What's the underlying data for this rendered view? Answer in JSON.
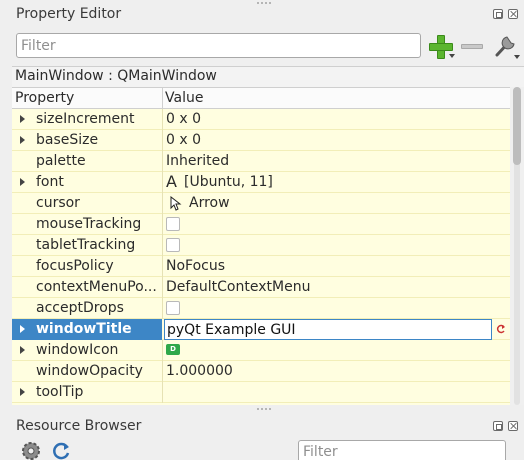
{
  "property_editor": {
    "title": "Property Editor",
    "filter_placeholder": "Filter",
    "object_label": "MainWindow : QMainWindow",
    "headers": {
      "property": "Property",
      "value": "Value"
    },
    "rows": [
      {
        "name": "sizeIncrement",
        "value": "0 x 0",
        "expandable": true
      },
      {
        "name": "baseSize",
        "value": "0 x 0",
        "expandable": true
      },
      {
        "name": "palette",
        "value": "Inherited",
        "expandable": false
      },
      {
        "name": "font",
        "value": "[Ubuntu, 11]",
        "expandable": true,
        "glyph": "A"
      },
      {
        "name": "cursor",
        "value": "Arrow",
        "expandable": false
      },
      {
        "name": "mouseTracking",
        "value": "",
        "expandable": false,
        "checkbox": true
      },
      {
        "name": "tabletTracking",
        "value": "",
        "expandable": false,
        "checkbox": true
      },
      {
        "name": "focusPolicy",
        "value": "NoFocus",
        "expandable": false
      },
      {
        "name": "contextMenuPo...",
        "value": "DefaultContextMenu",
        "expandable": false
      },
      {
        "name": "acceptDrops",
        "value": "",
        "expandable": false,
        "checkbox": true
      },
      {
        "name": "windowTitle",
        "value": "pyQt Example GUI",
        "expandable": true,
        "selected": true
      },
      {
        "name": "windowIcon",
        "value": "",
        "expandable": true,
        "icon_badge": "D"
      },
      {
        "name": "windowOpacity",
        "value": "1.000000",
        "expandable": false
      },
      {
        "name": "toolTip",
        "value": "",
        "expandable": true
      }
    ]
  },
  "resource_browser": {
    "title": "Resource Browser",
    "filter_placeholder": "Filter"
  },
  "colors": {
    "selection": "#3d86c6",
    "row_background": "#fffee0",
    "add_icon": "#5bb52f"
  },
  "icons": [
    "plus-icon",
    "minus-icon",
    "wrench-icon",
    "float-icon",
    "close-icon",
    "gear-icon",
    "reload-icon"
  ]
}
